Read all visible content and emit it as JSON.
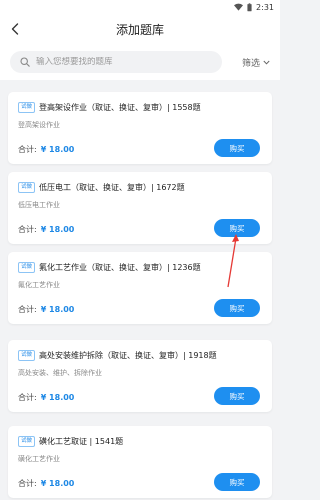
{
  "status_bar": {
    "time": "2:31"
  },
  "header": {
    "title": "添加题库"
  },
  "search": {
    "placeholder": "输入您想要找的题库",
    "value": ""
  },
  "filter": {
    "label": "筛选"
  },
  "labels": {
    "trial_tag": "试做",
    "total_label": "合计:",
    "buy_button": "购买"
  },
  "items": [
    {
      "title": "登高架设作业（取证、换证、复审）| 1558题",
      "subtitle": "登高架设作业",
      "price": "¥ 18.00"
    },
    {
      "title": "低压电工（取证、换证、复审）| 1672题",
      "subtitle": "低压电工作业",
      "price": "¥ 18.00"
    },
    {
      "title": "氟化工艺作业（取证、换证、复审）| 1236题",
      "subtitle": "氟化工艺作业",
      "price": "¥ 18.00"
    },
    {
      "title": "高处安装维护拆除（取证、换证、复审）| 1918题",
      "subtitle": "高处安装、维护、拆除作业",
      "price": "¥ 18.00"
    },
    {
      "title": "磺化工艺取证 | 1541题",
      "subtitle": "磺化工艺作业",
      "price": "¥ 18.00"
    }
  ],
  "colors": {
    "accent": "#1e8ff0",
    "price": "#1e88e5",
    "annotation": "#e53935"
  },
  "icons": [
    "back-arrow-icon",
    "search-icon",
    "chevron-down-icon",
    "wifi-icon",
    "battery-icon"
  ]
}
